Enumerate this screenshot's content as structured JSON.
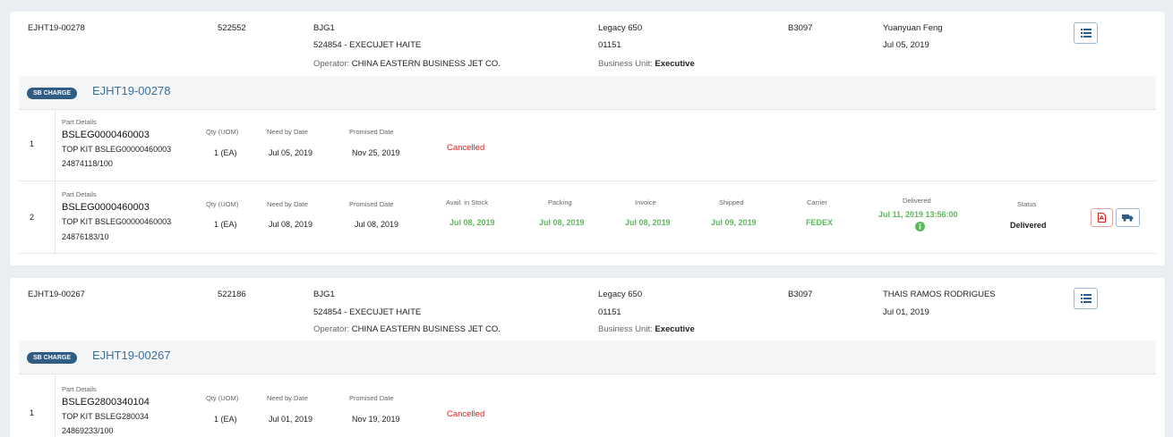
{
  "orders": [
    {
      "order_no": "EJHT19-00278",
      "ref_no": "522552",
      "station": "BJG1",
      "customer": "524854 - EXECUJET HAITE",
      "operator_label": "Operator:",
      "operator": "CHINA EASTERN BUSINESS JET CO.",
      "aircraft": "Legacy 650",
      "serial": "01151",
      "business_unit_label": "Business Unit:",
      "business_unit": "Executive",
      "tail": "B3097",
      "requester": "Yuanyuan Feng",
      "date": "Jul 05, 2019",
      "charge_badge": "SB CHARGE",
      "charge_title": "EJHT19-00278",
      "lines": [
        {
          "num": "1",
          "part_label": "Part Details",
          "part_no": "BSLEG0000460003",
          "description": "TOP KIT BSLEG00000460003",
          "po": "24874118/100",
          "qty_label": "Qty (UOM)",
          "qty": "1 (EA)",
          "need_label": "Need by Date",
          "need": "Jul 05, 2019",
          "promised_label": "Promised Date",
          "promised": "Nov 25, 2019",
          "status": "Cancelled"
        },
        {
          "num": "2",
          "part_label": "Part Details",
          "part_no": "BSLEG0000460003",
          "description": "TOP KIT BSLEG00000460003",
          "po": "24876183/10",
          "qty_label": "Qty (UOM)",
          "qty": "1 (EA)",
          "need_label": "Need by Date",
          "need": "Jul 08, 2019",
          "promised_label": "Promised Date",
          "promised": "Jul 08, 2019",
          "stock_label": "Avail. in Stock",
          "stock": "Jul 08, 2019",
          "packing_label": "Packing",
          "packing": "Jul 08, 2019",
          "invoice_label": "Invoice",
          "invoice": "Jul 08, 2019",
          "shipped_label": "Shipped",
          "shipped": "Jul 09, 2019",
          "carrier_label": "Carrier",
          "carrier": "FEDEX",
          "delivered_label": "Delivered",
          "delivered": "Jul 11, 2019 13:56:00",
          "status_label": "Status",
          "status": "Delivered"
        }
      ]
    },
    {
      "order_no": "EJHT19-00267",
      "ref_no": "522186",
      "station": "BJG1",
      "customer": "524854 - EXECUJET HAITE",
      "operator_label": "Operator:",
      "operator": "CHINA EASTERN BUSINESS JET CO.",
      "aircraft": "Legacy 650",
      "serial": "01151",
      "business_unit_label": "Business Unit:",
      "business_unit": "Executive",
      "tail": "B3097",
      "requester": "THAIS RAMOS RODRIGUES",
      "date": "Jul 01, 2019",
      "charge_badge": "SB CHARGE",
      "charge_title": "EJHT19-00267",
      "lines": [
        {
          "num": "1",
          "part_label": "Part Details",
          "part_no": "BSLEG2800340104",
          "description": "TOP KIT BSLEG280034",
          "po": "24869233/100",
          "qty_label": "Qty (UOM)",
          "qty": "1 (EA)",
          "need_label": "Need by Date",
          "need": "Jul 01, 2019",
          "promised_label": "Promised Date",
          "promised": "Nov 19, 2019",
          "status": "Cancelled"
        }
      ]
    }
  ],
  "colors": {
    "accent": "#2f5d85",
    "link": "#3a6f9c",
    "success": "#5cb85c",
    "danger": "#d92020",
    "background": "#eaedf1"
  },
  "icons": {
    "list": "list-icon",
    "pdf": "pdf-icon",
    "truck": "truck-icon",
    "info": "info-icon"
  }
}
